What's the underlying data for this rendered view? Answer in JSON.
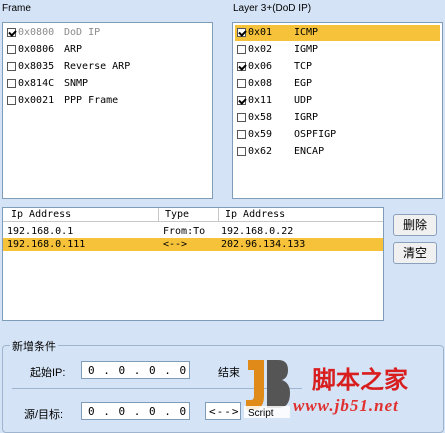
{
  "frame": {
    "title": "Frame",
    "items": [
      {
        "code": "0x0800",
        "name": "DoD IP",
        "checked": true,
        "disabled": true
      },
      {
        "code": "0x0806",
        "name": "ARP",
        "checked": false
      },
      {
        "code": "0x8035",
        "name": "Reverse ARP",
        "checked": false
      },
      {
        "code": "0x814C",
        "name": "SNMP",
        "checked": false
      },
      {
        "code": "0x0021",
        "name": "PPP Frame",
        "checked": false
      }
    ]
  },
  "layer3": {
    "title": "Layer 3+(DoD IP)",
    "items": [
      {
        "code": "0x01",
        "name": "ICMP",
        "checked": true,
        "selected": true
      },
      {
        "code": "0x02",
        "name": "IGMP",
        "checked": false
      },
      {
        "code": "0x06",
        "name": "TCP",
        "checked": true
      },
      {
        "code": "0x08",
        "name": "EGP",
        "checked": false
      },
      {
        "code": "0x11",
        "name": "UDP",
        "checked": true
      },
      {
        "code": "0x58",
        "name": "IGRP",
        "checked": false
      },
      {
        "code": "0x59",
        "name": "OSPFIGP",
        "checked": false
      },
      {
        "code": "0x62",
        "name": "ENCAP",
        "checked": false
      }
    ]
  },
  "iptable": {
    "headers": [
      "Ip Address",
      "Type",
      "Ip Address"
    ],
    "rows": [
      {
        "ip1": "192.168.0.1",
        "type": "From:To",
        "ip2": "192.168.0.22",
        "selected": false
      },
      {
        "ip1": "192.168.0.111",
        "type": "<-->",
        "ip2": "202.96.134.133",
        "selected": true
      }
    ]
  },
  "buttons": {
    "delete": "删除",
    "clear": "清空"
  },
  "condition": {
    "group_title": "新增条件",
    "start_ip_label": "起始IP:",
    "start_ip_value": "0 . 0 . 0 . 0",
    "end_ip_label": "结束",
    "src_dst_label": "源/目标:",
    "src_dst_value": "0 . 0 . 0 . 0",
    "direction_value": "<-->"
  },
  "watermark": {
    "logo_text": "Script",
    "site_name": "脚本之家",
    "site_url": "www.jb51.net"
  },
  "colors": {
    "selection": "#f5c23a",
    "panel": "#d4e3f5",
    "watermark_red": "#d81e1e"
  }
}
